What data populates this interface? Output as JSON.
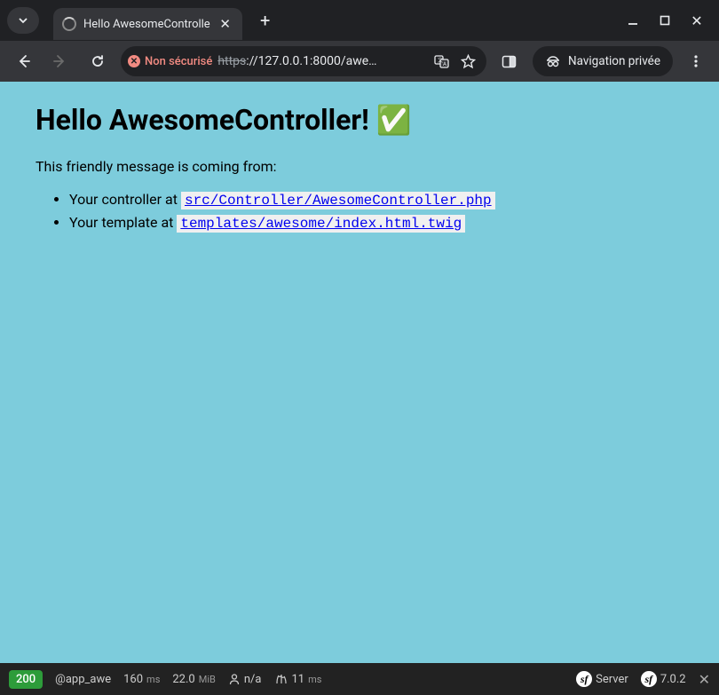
{
  "browser": {
    "tab_title": "Hello AwesomeControlle",
    "insecure_label": "Non sécurisé",
    "url_protocol": "https",
    "url_rest": "://127.0.0.1:8000/awe…",
    "incognito_label": "Navigation privée"
  },
  "page": {
    "heading": "Hello AwesomeController! ✅",
    "intro": "This friendly message is coming from:",
    "item1_prefix": "Your controller at ",
    "item1_code": "src/Controller/AwesomeController.php",
    "item2_prefix": "Your template at ",
    "item2_code": "templates/awesome/index.html.twig"
  },
  "debug": {
    "status": "200",
    "route": "@app_awe",
    "time_val": "160",
    "time_unit": "ms",
    "mem_val": "22.0",
    "mem_unit": "MiB",
    "user": "n/a",
    "twig_val": "11",
    "twig_unit": "ms",
    "server_label": "Server",
    "version": "7.0.2"
  }
}
